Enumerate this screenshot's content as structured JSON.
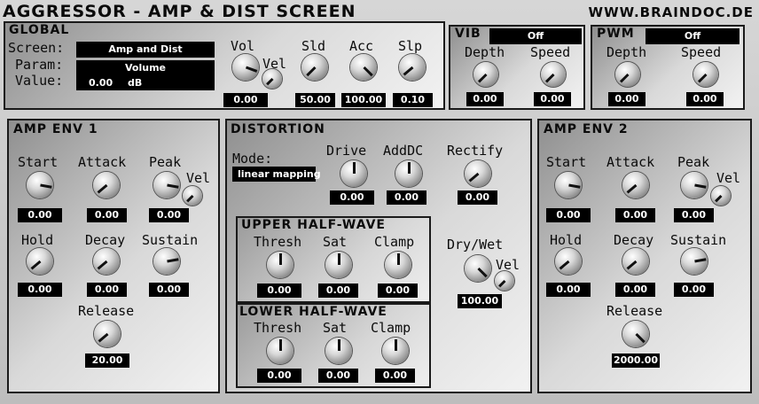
{
  "header": {
    "title": "AGGRESSOR - AMP & DIST SCREEN",
    "site": "WWW.BRAINDOC.DE"
  },
  "global": {
    "title": "GLOBAL",
    "screen_label": "Screen:",
    "screen_value": "Amp and Dist",
    "param_label": "Param:",
    "param_value": "Volume",
    "value_label": "Value:",
    "value_number": "0.00",
    "value_unit": "dB",
    "knobs": {
      "vol": {
        "label": "Vol",
        "value": "0.00"
      },
      "vel": {
        "label": "Vel"
      },
      "sld": {
        "label": "Sld",
        "value": "50.00"
      },
      "acc": {
        "label": "Acc",
        "value": "100.00"
      },
      "slp": {
        "label": "Slp",
        "value": "0.10"
      }
    }
  },
  "vib": {
    "title": "VIB",
    "mode": "Off",
    "depth": {
      "label": "Depth",
      "value": "0.00"
    },
    "speed": {
      "label": "Speed",
      "value": "0.00"
    }
  },
  "pwm": {
    "title": "PWM",
    "mode": "Off",
    "depth": {
      "label": "Depth",
      "value": "0.00"
    },
    "speed": {
      "label": "Speed",
      "value": "0.00"
    }
  },
  "amp_env_1": {
    "title": "AMP ENV 1",
    "start": {
      "label": "Start",
      "value": "0.00"
    },
    "attack": {
      "label": "Attack",
      "value": "0.00"
    },
    "peak": {
      "label": "Peak",
      "value": "0.00"
    },
    "vel": {
      "label": "Vel"
    },
    "hold": {
      "label": "Hold",
      "value": "0.00"
    },
    "decay": {
      "label": "Decay",
      "value": "0.00"
    },
    "sustain": {
      "label": "Sustain",
      "value": "0.00"
    },
    "release": {
      "label": "Release",
      "value": "20.00"
    }
  },
  "distortion": {
    "title": "DISTORTION",
    "mode_label": "Mode:",
    "mode_value": "linear mapping",
    "drive": {
      "label": "Drive",
      "value": "0.00"
    },
    "adddc": {
      "label": "AddDC",
      "value": "0.00"
    },
    "rectify": {
      "label": "Rectify",
      "value": "0.00"
    },
    "drywet": {
      "label": "Dry/Wet",
      "value": "100.00"
    },
    "vel": {
      "label": "Vel"
    },
    "upper": {
      "title": "UPPER HALF-WAVE",
      "thresh": {
        "label": "Thresh",
        "value": "0.00"
      },
      "sat": {
        "label": "Sat",
        "value": "0.00"
      },
      "clamp": {
        "label": "Clamp",
        "value": "0.00"
      }
    },
    "lower": {
      "title": "LOWER HALF-WAVE",
      "thresh": {
        "label": "Thresh",
        "value": "0.00"
      },
      "sat": {
        "label": "Sat",
        "value": "0.00"
      },
      "clamp": {
        "label": "Clamp",
        "value": "0.00"
      }
    }
  },
  "amp_env_2": {
    "title": "AMP ENV 2",
    "start": {
      "label": "Start",
      "value": "0.00"
    },
    "attack": {
      "label": "Attack",
      "value": "0.00"
    },
    "peak": {
      "label": "Peak",
      "value": "0.00"
    },
    "vel": {
      "label": "Vel"
    },
    "hold": {
      "label": "Hold",
      "value": "0.00"
    },
    "decay": {
      "label": "Decay",
      "value": "0.00"
    },
    "sustain": {
      "label": "Sustain",
      "value": "0.00"
    },
    "release": {
      "label": "Release",
      "value": "2000.00"
    }
  }
}
